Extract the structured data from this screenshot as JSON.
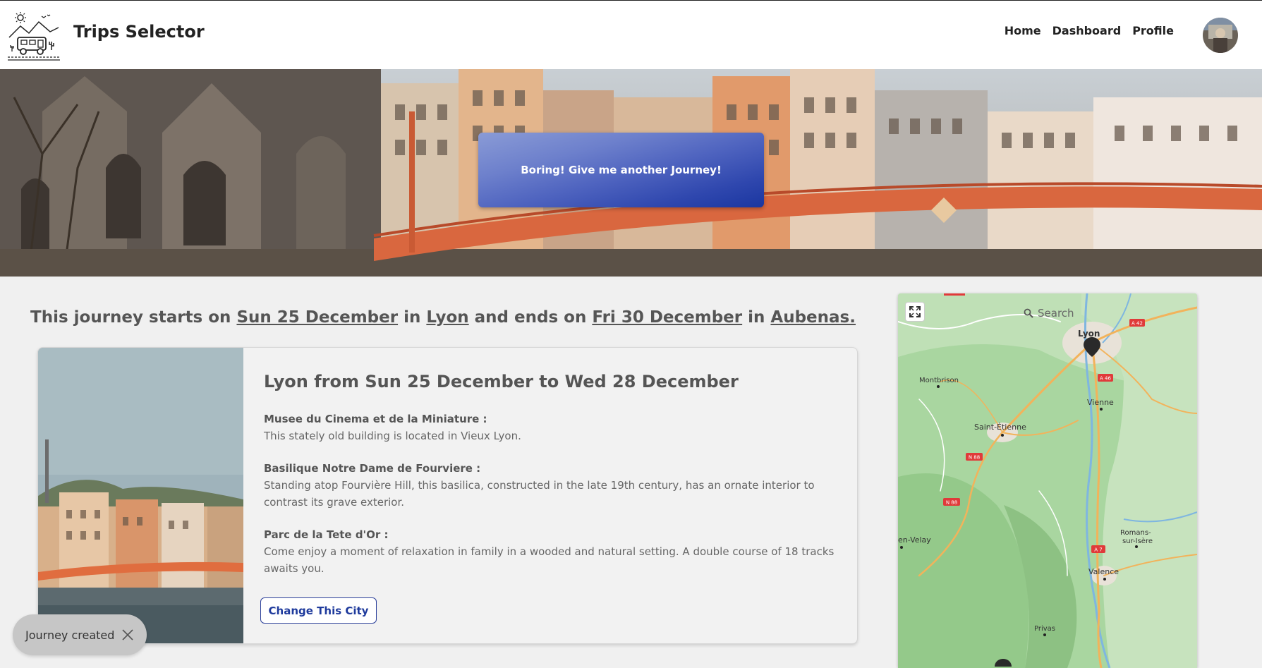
{
  "header": {
    "brand": "Trips Selector",
    "nav": {
      "home": "Home",
      "dashboard": "Dashboard",
      "profile": "Profile"
    }
  },
  "hero": {
    "button_label": "Boring! Give me another Journey!"
  },
  "journey": {
    "prefix": "This journey starts on ",
    "start_date": "Sun 25 December",
    "in1": " in ",
    "start_city": "Lyon",
    "mid": " and ends on ",
    "end_date": "Fri 30 December",
    "in2": " in ",
    "end_city": "Aubenas."
  },
  "card": {
    "title": "Lyon from Sun 25 December to Wed 28 December",
    "places": [
      {
        "name": "Musee du Cinema et de la Miniature :",
        "description": "This stately old building is located in Vieux Lyon."
      },
      {
        "name": "Basilique Notre Dame de Fourviere :",
        "description": "Standing atop Fourvière Hill, this basilica, constructed in the late 19th century, has an ornate interior to contrast its grave exterior."
      },
      {
        "name": "Parc de la Tete d'Or :",
        "description": "Come enjoy a moment of relaxation in family in a wooded and natural setting. A double course of 18 tracks awaits you."
      }
    ],
    "change_button": "Change This City"
  },
  "map": {
    "search_placeholder": "Search",
    "labels": {
      "lyon": "Lyon",
      "montbrison": "Montbrison",
      "vienne": "Vienne",
      "saint_etienne": "Saint-Étienne",
      "en_velay": "en-Velay",
      "romans1": "Romans-",
      "romans2": "sur-Isère",
      "valence": "Valence",
      "privas": "Privas",
      "a42": "A 42",
      "a46": "A 46",
      "n88a": "N 88",
      "n88b": "N 88",
      "a7": "A 7"
    }
  },
  "toast": {
    "text": "Journey created"
  },
  "colors": {
    "accent": "#1e3a9c",
    "road_badge": "#e03a3a",
    "map_green": "#a9d6a0"
  }
}
